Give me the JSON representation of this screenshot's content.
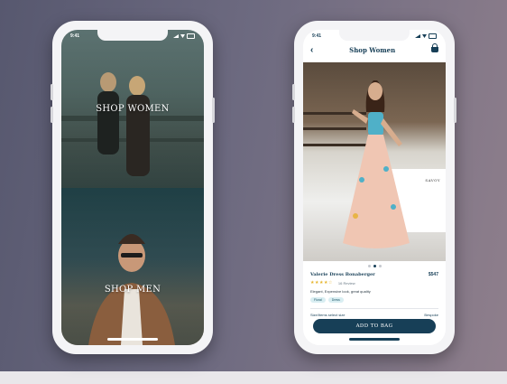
{
  "left_phone": {
    "status": {
      "time": "9:41"
    },
    "sections": {
      "women_label": "SHOP WOMEN",
      "men_label": "SHOP MEN"
    }
  },
  "right_phone": {
    "status": {
      "time": "9:41"
    },
    "nav": {
      "title": "Shop Women",
      "back_icon": "chevron-left-icon",
      "cart_icon": "basket-icon"
    },
    "hero": {
      "counter_text": "SAVOY"
    },
    "carousel": {
      "total": 3,
      "active": 1
    },
    "product": {
      "name": "Valerie Dress Bonaberger",
      "price": "$547",
      "stars": "★★★★☆",
      "reviews": "16 Review",
      "description": "Elegant, Expensive look, great quality",
      "tags": [
        "Floral",
        "Dress"
      ],
      "size_label": "Size/Items select size",
      "size_value": "Bespoke"
    },
    "cta": {
      "label": "ADD TO BAG"
    }
  },
  "colors": {
    "primary": "#173f57",
    "star": "#e6b42b",
    "tag_bg": "#d9eef2"
  }
}
